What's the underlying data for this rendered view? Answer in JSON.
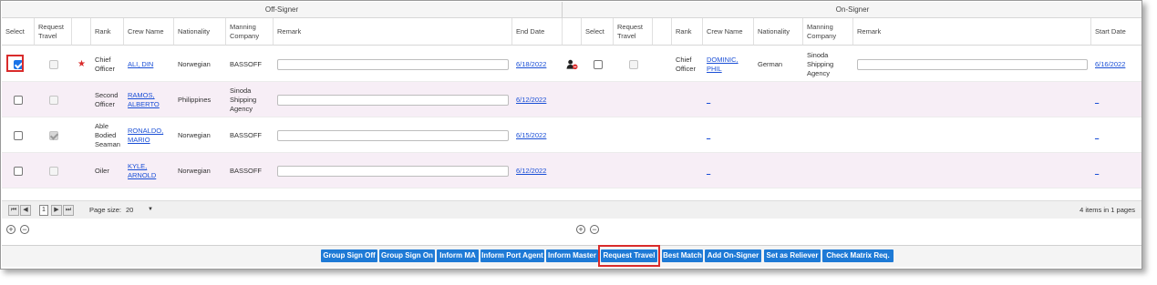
{
  "headers": {
    "off_group": "Off-Signer",
    "on_group": "On-Signer",
    "off_cols": [
      "Select",
      "Request Travel",
      "",
      "Rank",
      "Crew Name",
      "Nationality",
      "Manning Company",
      "Remark",
      "End Date"
    ],
    "on_cols": [
      "",
      "Select",
      "Request Travel",
      "",
      "Rank",
      "Crew Name",
      "Nationality",
      "Manning Company",
      "Remark",
      "Start Date"
    ]
  },
  "rows": [
    {
      "off": {
        "rank": "Chief Officer",
        "crew_name": "ALI, DIN",
        "nationality": "Norwegian",
        "manning": "BASSOFF",
        "remark": "",
        "end_date": "6/18/2022"
      },
      "on": {
        "rank": "Chief Officer",
        "crew_name": "DOMINIC, PHIL",
        "nationality": "German",
        "manning": "Sinoda Shipping Agency",
        "remark": "",
        "start_date": "6/16/2022"
      }
    },
    {
      "off": {
        "rank": "Second Officer",
        "crew_name": "RAMOS, ALBERTO",
        "nationality": "Philippines",
        "manning": "Sinoda Shipping Agency",
        "remark": "",
        "end_date": "6/12/2022"
      },
      "on": {
        "crew_name": "_",
        "start_date": "_"
      }
    },
    {
      "off": {
        "rank": "Able Bodied Seaman",
        "crew_name": "RONALDO, MARIO",
        "nationality": "Norwegian",
        "manning": "BASSOFF",
        "remark": "",
        "end_date": "6/15/2022"
      },
      "on": {
        "crew_name": "_",
        "start_date": "_"
      }
    },
    {
      "off": {
        "rank": "Oiler",
        "crew_name": "KYLE, ARNOLD",
        "nationality": "Norwegian",
        "manning": "BASSOFF",
        "remark": "",
        "end_date": "6/12/2022"
      },
      "on": {
        "crew_name": "_",
        "start_date": "_"
      }
    }
  ],
  "pager": {
    "first": "⏮",
    "prev": "◀",
    "page": "1",
    "next": "▶",
    "last": "⏭",
    "page_size_label": "Page size:",
    "page_size": "20",
    "summary": "4 items in 1 pages"
  },
  "icons": {
    "flag": "red-star-icon",
    "remove_crew": "person-remove-icon",
    "add": "plus-circle-icon",
    "remove": "minus-circle-icon"
  },
  "buttons": [
    "Group Sign Off",
    "Group Sign On",
    "Inform MA",
    "Inform Port Agent",
    "Inform Master",
    "Request Travel",
    "Best Match",
    "Add On-Signer",
    "Set as Reliever",
    "Check Matrix Req."
  ],
  "colors": {
    "button_bg": "#1e7ad6",
    "highlight": "#d92b2b",
    "link": "#1a4fd6",
    "alt_row": "#f7eef6"
  }
}
